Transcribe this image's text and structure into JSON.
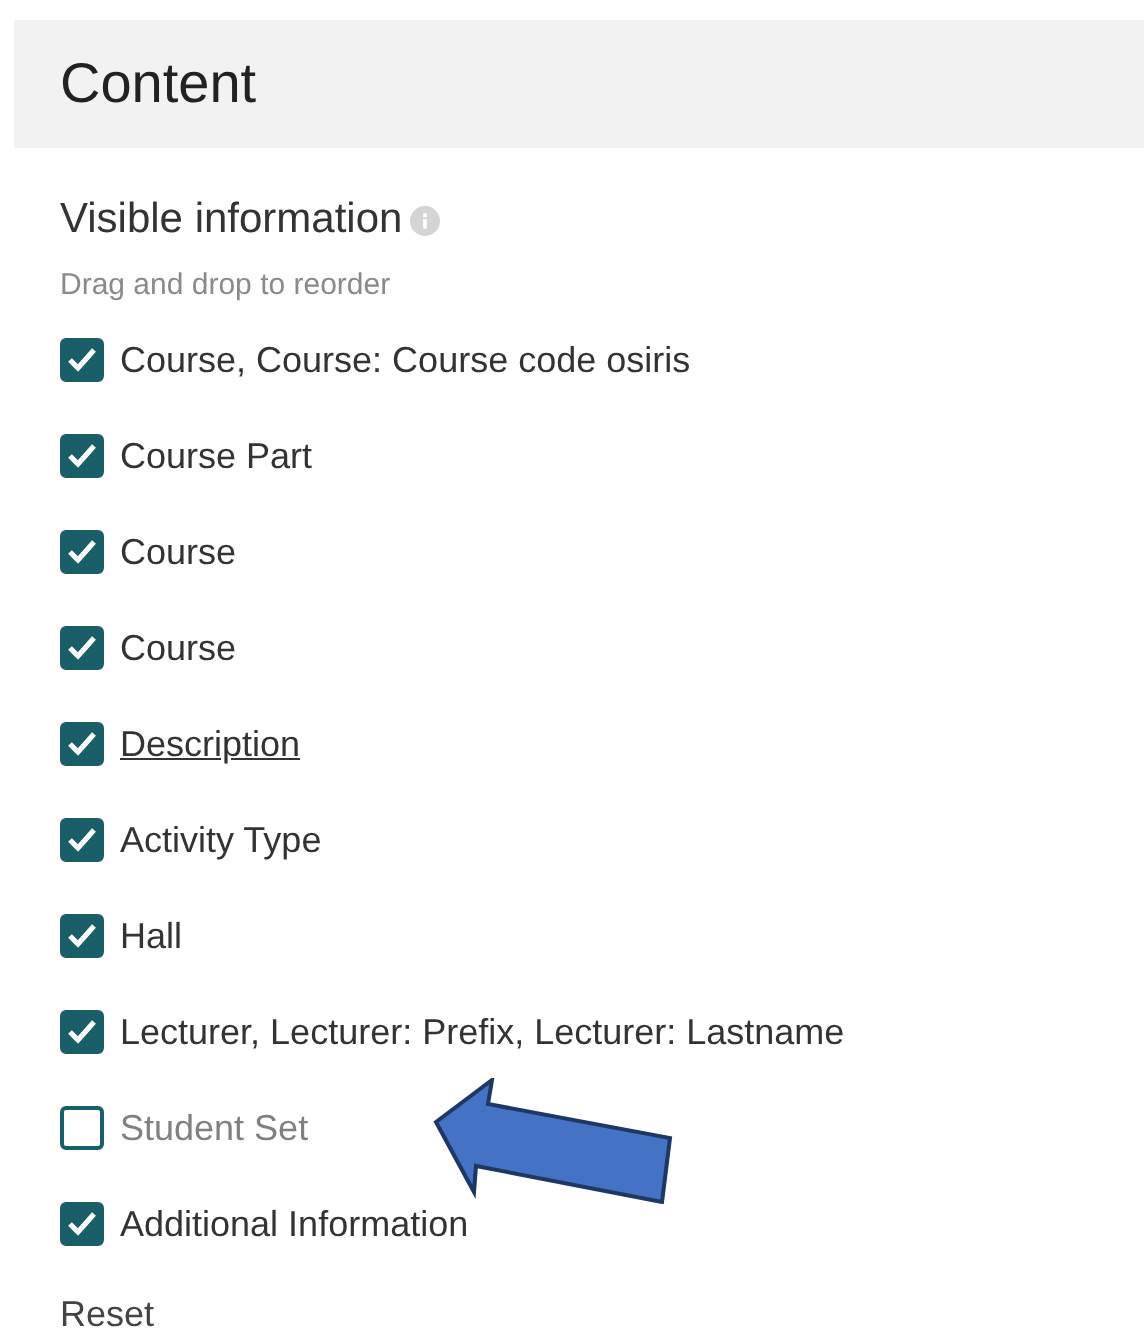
{
  "section": {
    "title": "Content"
  },
  "group": {
    "title": "Visible information",
    "hint": "Drag and drop to reorder"
  },
  "items": [
    {
      "label": "Course, Course: Course code osiris",
      "checked": true,
      "underlined": false
    },
    {
      "label": "Course Part",
      "checked": true,
      "underlined": false
    },
    {
      "label": "Course",
      "checked": true,
      "underlined": false
    },
    {
      "label": "Course",
      "checked": true,
      "underlined": false
    },
    {
      "label": "Description",
      "checked": true,
      "underlined": true
    },
    {
      "label": "Activity Type",
      "checked": true,
      "underlined": false
    },
    {
      "label": "Hall",
      "checked": true,
      "underlined": false
    },
    {
      "label": "Lecturer, Lecturer: Prefix, Lecturer: Lastname",
      "checked": true,
      "underlined": false
    },
    {
      "label": "Student Set",
      "checked": false,
      "underlined": false
    },
    {
      "label": "Additional Information",
      "checked": true,
      "underlined": false
    }
  ],
  "reset": "Reset"
}
